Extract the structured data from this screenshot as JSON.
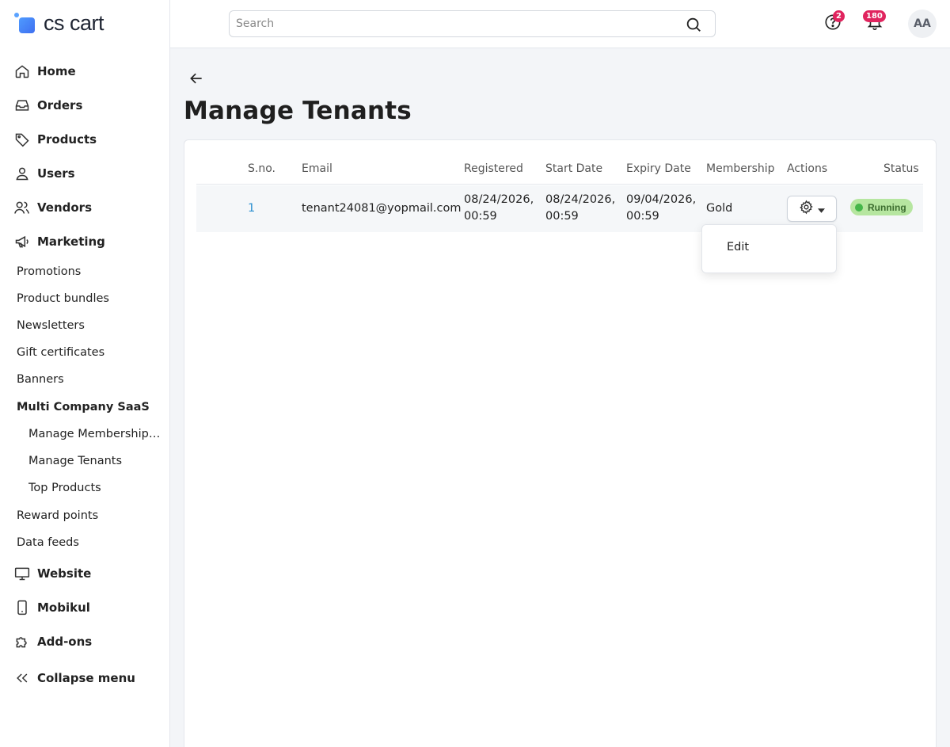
{
  "app": {
    "logo_text": "cs cart"
  },
  "sidebar": {
    "home": "Home",
    "orders": "Orders",
    "products": "Products",
    "users": "Users",
    "vendors": "Vendors",
    "marketing": "Marketing",
    "promotions": "Promotions",
    "product_bundles": "Product bundles",
    "newsletters": "Newsletters",
    "gift_certificates": "Gift certificates",
    "banners": "Banners",
    "multi_company_saas": "Multi Company SaaS",
    "manage_membership_plans": "Manage Membership Pl...",
    "manage_tenants": "Manage Tenants",
    "top_products": "Top Products",
    "reward_points": "Reward points",
    "data_feeds": "Data feeds",
    "website": "Website",
    "mobikul": "Mobikul",
    "addons": "Add-ons",
    "collapse_menu": "Collapse menu"
  },
  "header": {
    "search_placeholder": "Search",
    "help_badge": "2",
    "notifications_badge": "180",
    "avatar_initials": "AA"
  },
  "page": {
    "title": "Manage Tenants"
  },
  "table": {
    "columns": {
      "sno": "S.no.",
      "email": "Email",
      "registered": "Registered",
      "start_date": "Start Date",
      "expiry_date": "Expiry Date",
      "membership": "Membership",
      "actions": "Actions",
      "status": "Status"
    },
    "rows": [
      {
        "sno": "1",
        "email": "tenant24081@yopmail.com",
        "registered_date": "08/24/2026,",
        "registered_time": "00:59",
        "start_date": "08/24/2026,",
        "start_time": "00:59",
        "expiry_date": "09/04/2026,",
        "expiry_time": "00:59",
        "membership": "Gold",
        "status": "Running"
      }
    ]
  },
  "actions_menu": {
    "edit": "Edit"
  },
  "colors": {
    "accent": "#2a8fd0",
    "badge": "#e0245e",
    "status_running": "#b6e6a0"
  }
}
